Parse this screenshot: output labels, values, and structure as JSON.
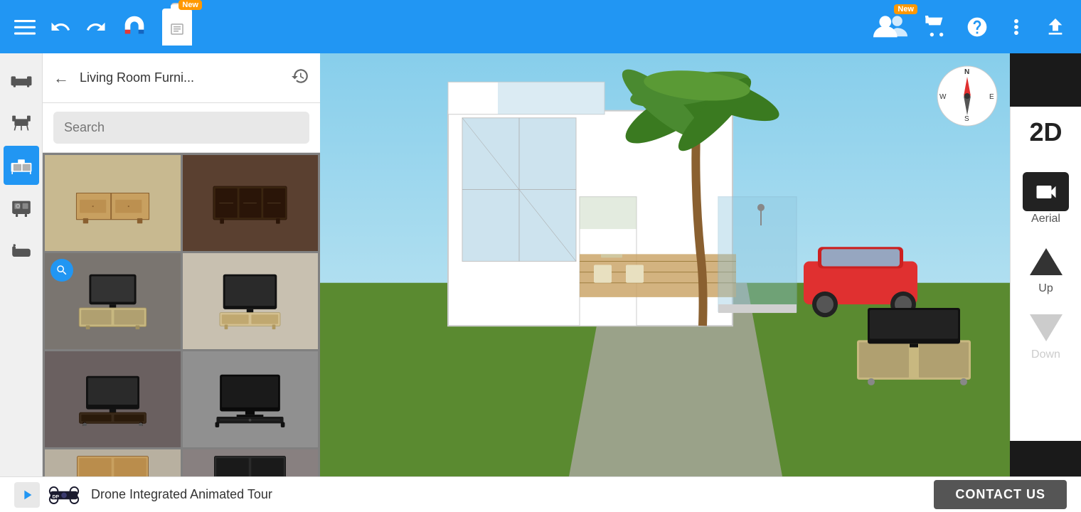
{
  "toolbar": {
    "menu_icon": "☰",
    "undo_label": "↩",
    "redo_label": "↪",
    "new_badge": "New",
    "users_badge": "New",
    "cart_icon": "🛒",
    "help_icon": "?",
    "more_icon": "⋮",
    "upload_icon": "⬆"
  },
  "panel": {
    "title": "Living Room Furni...",
    "search_placeholder": "Search",
    "back_label": "←",
    "history_label": "🕐"
  },
  "right_controls": {
    "view_2d": "2D",
    "aerial_label": "Aerial",
    "up_label": "Up",
    "down_label": "Down"
  },
  "ad_bar": {
    "ad_text": "Drone Integrated Animated Tour",
    "contact_label": "CONTACT US"
  }
}
